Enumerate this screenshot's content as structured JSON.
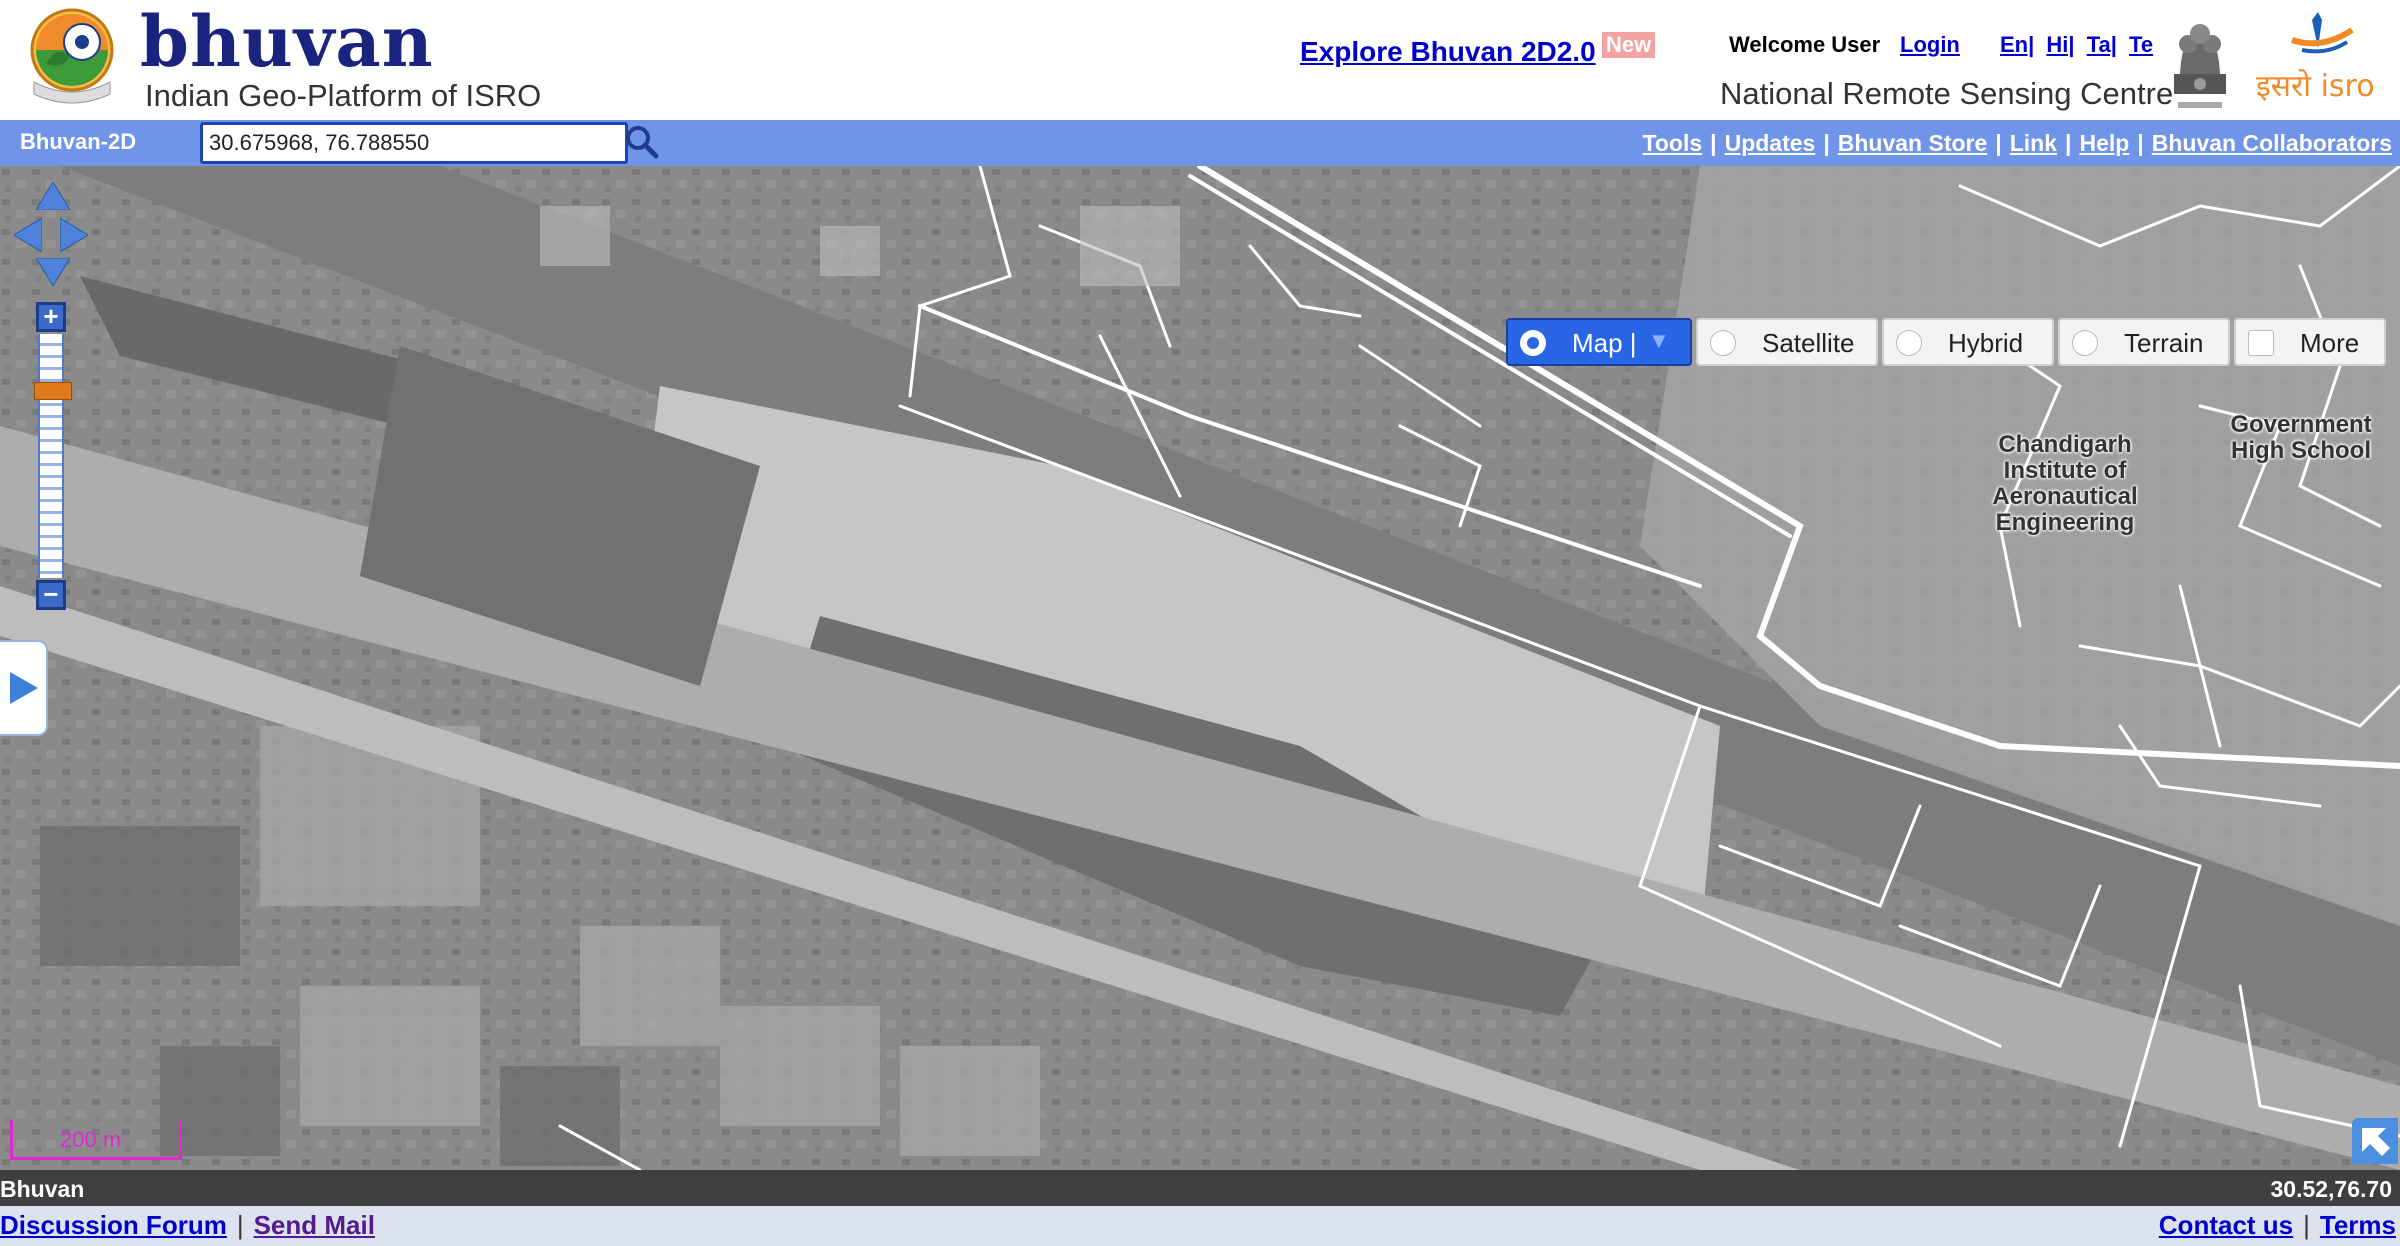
{
  "header": {
    "brand_name": "bhuvan",
    "brand_tagline": "Indian Geo-Platform of ISRO",
    "explore_link": "Explore Bhuvan 2D2.0",
    "new_badge": "New",
    "welcome_text": "Welcome User",
    "login_link": "Login",
    "languages": [
      {
        "label": "En|"
      },
      {
        "label": "Hi|"
      },
      {
        "label": "Ta|"
      },
      {
        "label": "Te"
      }
    ],
    "org_name": "National Remote Sensing Centre",
    "isro_logo_text": "इसरो isro"
  },
  "toolbar": {
    "app_label": "Bhuvan-2D",
    "search_value": "30.675968, 76.788550",
    "search_icon": "search-icon",
    "nav_links": [
      {
        "label": "Tools"
      },
      {
        "label": "Updates"
      },
      {
        "label": "Bhuvan Store"
      },
      {
        "label": "Link"
      },
      {
        "label": "Help"
      },
      {
        "label": "Bhuvan Collaborators"
      }
    ]
  },
  "map": {
    "layers": {
      "map": "Map |",
      "satellite": "Satellite",
      "hybrid": "Hybrid",
      "terrain": "Terrain",
      "more": "More"
    },
    "active_layer": "map",
    "labels": {
      "institute": "Chandigarh Institute of Aeronautical Engineering",
      "school": "Government High School"
    },
    "scale_label": "200 m",
    "zoom_level_fraction": 0.2,
    "colors": {
      "toolbar_bg": "#6f94e8",
      "active_layer_bg": "#2966e6",
      "zoom_handle": "#e07a1a",
      "scale_bar": "#e02ad1"
    }
  },
  "status": {
    "left": "Bhuvan",
    "coords": "30.52,76.70"
  },
  "footer": {
    "discussion_forum": "Discussion Forum",
    "send_mail": "Send Mail",
    "contact_us": "Contact us",
    "terms": "Terms",
    "separator": "|"
  }
}
